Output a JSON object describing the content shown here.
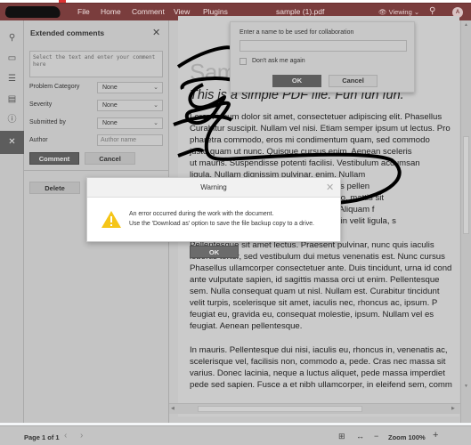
{
  "app": {
    "menu": [
      "File",
      "Home",
      "Comment",
      "View",
      "Plugins"
    ],
    "document_title": "sample (1).pdf",
    "mode_label": "Viewing",
    "avatar_initial": "A",
    "accent_color": "#7a3d3d"
  },
  "left_toolbar": {
    "icons": [
      "search-icon",
      "comment-icon",
      "navigation-icon",
      "page-thumbnails-icon",
      "info-icon",
      "tools-icon"
    ],
    "active": "tools-icon"
  },
  "panel": {
    "title": "Extended comments",
    "comment_placeholder": "Select the text and enter your comment here",
    "fields": [
      {
        "label": "Problem Category",
        "value": "None"
      },
      {
        "label": "Severity",
        "value": "None"
      },
      {
        "label": "Submitted by",
        "value": "None"
      }
    ],
    "author_label": "Author",
    "author_placeholder": "Author name",
    "comment_button": "Comment",
    "cancel_button": "Cancel",
    "delete_button": "Delete"
  },
  "document": {
    "heading": "Sample PDF",
    "subheading": "This is a simple PDF file. Fun fun fun.",
    "paragraph1": [
      "Lorem ipsum dolor sit amet, consectetuer adipiscing elit. Phasellus",
      "Curabitur suscipit. Nullam vel nisi. Etiam semper ipsum ut lectus. Pro",
      "pharetra commodo, eros mi condimentum quam, sed commodo",
      "justo quam ut nunc. Quisque cursus enim. Aenean sceleris",
      "ut mauris. Suspendisse potenti facilisi. Vestibulum accumsan",
      "ligula. Nullam dignissim pulvinar, enim. Nullam",
      "nisi ut lectus interdum eleifend, nisi tellus pellen",
      "gravida sit amet. Suspendisse libero odio, mattis sit",
      "metus sed diam. Aliquam erat volutpat. Aliquam f",
      "ullamcorper. Aenean pretium mollis. Proin velit ligula, s"
    ],
    "paragraph2": [
      "Pellentesque sit amet lectus. Praesent pulvinar, nunc quis iaculis",
      "lobortis tortor, sed vestibulum dui metus venenatis est. Nunc cursus",
      "Phasellus ullamcorper consectetuer ante. Duis tincidunt, urna id cond",
      "ante vulputate sapien, id sagittis massa orci ut enim. Pellentesque",
      "sem. Nulla consequat quam ut nisl. Nullam est. Curabitur tincidunt",
      "velit turpis, scelerisque sit amet, iaculis nec, rhoncus ac, ipsum. P",
      "feugiat eu, gravida eu, consequat molestie, ipsum. Nullam vel es",
      "feugiat. Aenean pellentesque."
    ],
    "paragraph3": [
      "In mauris. Pellentesque dui nisi, iaculis eu, rhoncus in, venenatis ac,",
      "scelerisque vel, facilisis non, commodo a, pede. Cras nec massa sit",
      "varius. Donec lacinia, neque a luctus aliquet, pede massa imperdiet",
      "pede sed sapien. Fusce a et nibh ullamcorper, in eleifend sem, comm"
    ]
  },
  "collab_dialog": {
    "label": "Enter a name to be used for collaboration",
    "input_value": "",
    "checkbox_label": "Don't ask me again",
    "checked": false,
    "ok": "OK",
    "cancel": "Cancel"
  },
  "warning_dialog": {
    "title": "Warning",
    "line1": "An error occurred during the work with the document.",
    "line2": "Use the 'Download as' option to save the file backup copy to a drive.",
    "ok": "OK",
    "icon_color": "#f5c518"
  },
  "status": {
    "page": "Page 1 of 1",
    "zoom": "Zoom 100%"
  }
}
